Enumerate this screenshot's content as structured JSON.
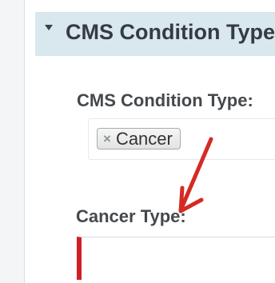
{
  "section": {
    "title": "CMS Condition Type"
  },
  "fields": {
    "condition_type_label": "CMS Condition Type:",
    "selected_tags": [
      {
        "label": "Cancer",
        "remove_symbol": "×"
      }
    ],
    "cancer_type_label": "Cancer Type:",
    "cancer_type_value": ""
  },
  "annotation": {
    "arrow_color": "#d42b24"
  },
  "icons": {
    "section_toggle": "caret-down-icon",
    "tag_remove": "close-icon"
  }
}
